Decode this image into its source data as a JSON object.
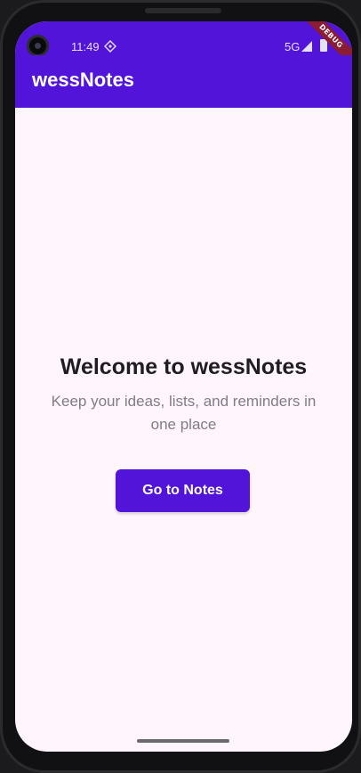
{
  "status_bar": {
    "time": "11:49",
    "network": "5G",
    "icons": [
      "camera-icon",
      "sim-icon",
      "signal-icon",
      "battery-icon"
    ]
  },
  "debug_banner": "DEBUG",
  "app_bar": {
    "title": "wessNotes",
    "color": "#5314d9"
  },
  "main": {
    "title": "Welcome to wessNotes",
    "subtitle": "Keep your ideas, lists, and reminders in one place",
    "button_label": "Go to Notes"
  }
}
